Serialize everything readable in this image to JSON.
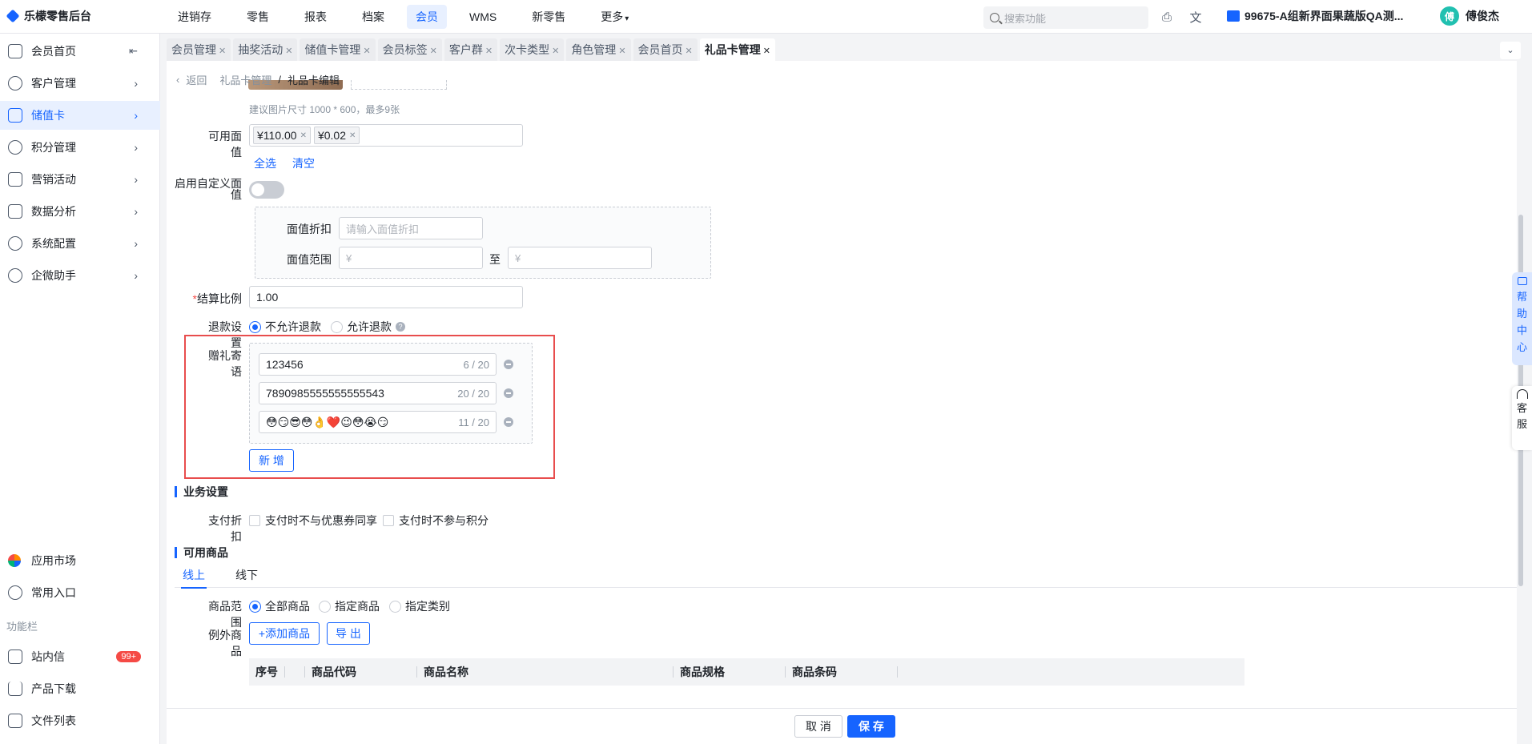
{
  "app": {
    "title": "乐檬零售后台"
  },
  "topnav": [
    {
      "label": "进销存"
    },
    {
      "label": "零售"
    },
    {
      "label": "报表"
    },
    {
      "label": "档案"
    },
    {
      "label": "会员"
    },
    {
      "label": "WMS"
    },
    {
      "label": "新零售"
    },
    {
      "label": "更多"
    }
  ],
  "topbar": {
    "search_placeholder": "搜索功能",
    "store": "99675-A组新界面果蔬版QA测...",
    "avatar_char": "傅",
    "user": "傅俊杰"
  },
  "sidebar": {
    "items": [
      {
        "label": "会员首页"
      },
      {
        "label": "客户管理"
      },
      {
        "label": "储值卡"
      },
      {
        "label": "积分管理"
      },
      {
        "label": "营销活动"
      },
      {
        "label": "数据分析"
      },
      {
        "label": "系统配置"
      },
      {
        "label": "企微助手"
      }
    ],
    "bottom": [
      {
        "label": "应用市场"
      },
      {
        "label": "常用入口"
      }
    ],
    "section_label": "功能栏",
    "tools": [
      {
        "label": "站内信",
        "badge": "99+"
      },
      {
        "label": "产品下载"
      },
      {
        "label": "文件列表"
      }
    ]
  },
  "tabs": [
    {
      "label": "会员管理"
    },
    {
      "label": "抽奖活动"
    },
    {
      "label": "储值卡管理"
    },
    {
      "label": "会员标签"
    },
    {
      "label": "客户群"
    },
    {
      "label": "次卡类型"
    },
    {
      "label": "角色管理"
    },
    {
      "label": "会员首页"
    },
    {
      "label": "礼品卡管理"
    }
  ],
  "breadcrumb": {
    "back": "返回",
    "parent": "礼品卡管理",
    "sep": "/",
    "current": "礼品卡编辑"
  },
  "form": {
    "image_hint": "建议图片尺寸 1000 * 600，最多9张",
    "face_value_label": "可用面值",
    "face_values": [
      "¥110.00",
      "¥0.02"
    ],
    "select_all": "全选",
    "clear": "清空",
    "custom_face_label_1": "启用自定义面",
    "custom_face_label_2": "值",
    "discount_label": "面值折扣",
    "discount_placeholder": "请输入面值折扣",
    "range_label": "面值范围",
    "range_from_prefix": "¥",
    "range_to": "至",
    "range_to_prefix": "¥",
    "settle_required": "*",
    "settle_label": "结算比例",
    "settle_value": "1.00",
    "refund_label": "退款设置",
    "refund_no": "不允许退款",
    "refund_yes": "允许退款",
    "refund_help": "?",
    "gift_label": "赠礼寄语",
    "gift_messages": [
      {
        "text": "123456",
        "count": "6 / 20"
      },
      {
        "text": "7890985555555555543",
        "count": "20 / 20"
      },
      {
        "text": "😳😏😎😳👌❤️😉😳😭😏",
        "count": "11 / 20"
      }
    ],
    "add_button": "新 增"
  },
  "business": {
    "title": "业务设置",
    "pay_discount_label": "支付折扣",
    "opt1": "支付时不与优惠券同享",
    "opt2": "支付时不参与积分"
  },
  "goods": {
    "title": "可用商品",
    "tab_online": "线上",
    "tab_offline": "线下",
    "scope_label": "商品范围",
    "scope_all": "全部商品",
    "scope_specific": "指定商品",
    "scope_category": "指定类别",
    "exception_label": "例外商品",
    "add_goods": "+添加商品",
    "export": "导 出",
    "columns": [
      "序号",
      "",
      "商品代码",
      "商品名称",
      "商品规格",
      "商品条码"
    ]
  },
  "footer": {
    "cancel": "取 消",
    "save": "保 存"
  },
  "float": {
    "help": [
      "帮",
      "助",
      "中",
      "心"
    ],
    "service": [
      "客",
      "服"
    ]
  },
  "colors": {
    "primary": "#1664ff",
    "highlight": "#e84d4d"
  }
}
